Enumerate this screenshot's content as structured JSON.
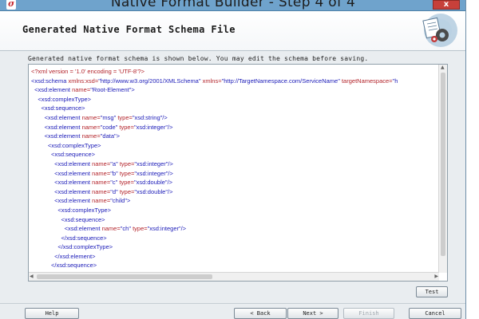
{
  "window": {
    "title": "Native Format Builder - Step 4 of 4",
    "close_label": "x",
    "app_icon_glyph": "σ"
  },
  "header": {
    "title": "Generated Native Format Schema File",
    "logo_icon": "gear-document-icon"
  },
  "description": "Generated native format schema is shown below. You may edit the schema before saving.",
  "code_lines": [
    [
      {
        "t": "pi",
        "v": "<?xml version = '1.0' encoding = 'UTF-8'?>"
      }
    ],
    [
      {
        "t": "tag",
        "v": "<xsd:schema "
      },
      {
        "t": "attr",
        "v": "xmlns:xsd="
      },
      {
        "t": "val",
        "v": "\"http://www.w3.org/2001/XMLSchema\" "
      },
      {
        "t": "attr",
        "v": "xmlns="
      },
      {
        "t": "val",
        "v": "\"http://TargetNamespace.com/ServiceName\" "
      },
      {
        "t": "attr",
        "v": "targetNamespace="
      },
      {
        "t": "val",
        "v": "\"h"
      }
    ],
    [
      {
        "t": "tag",
        "v": "  <xsd:element "
      },
      {
        "t": "attr",
        "v": "name="
      },
      {
        "t": "val",
        "v": "\"Root-Element\">"
      }
    ],
    [
      {
        "t": "tag",
        "v": "    <xsd:complexType>"
      }
    ],
    [
      {
        "t": "tag",
        "v": "      <xsd:sequence>"
      }
    ],
    [
      {
        "t": "tag",
        "v": "        <xsd:element "
      },
      {
        "t": "attr",
        "v": "name="
      },
      {
        "t": "val",
        "v": "\"msg\" "
      },
      {
        "t": "attr",
        "v": "type="
      },
      {
        "t": "val",
        "v": "\"xsd:string\"/>"
      }
    ],
    [
      {
        "t": "tag",
        "v": "        <xsd:element "
      },
      {
        "t": "attr",
        "v": "name="
      },
      {
        "t": "val",
        "v": "\"code\" "
      },
      {
        "t": "attr",
        "v": "type="
      },
      {
        "t": "val",
        "v": "\"xsd:integer\"/>"
      }
    ],
    [
      {
        "t": "tag",
        "v": "        <xsd:element "
      },
      {
        "t": "attr",
        "v": "name="
      },
      {
        "t": "val",
        "v": "\"data\">"
      }
    ],
    [
      {
        "t": "tag",
        "v": "          <xsd:complexType>"
      }
    ],
    [
      {
        "t": "tag",
        "v": "            <xsd:sequence>"
      }
    ],
    [
      {
        "t": "tag",
        "v": "              <xsd:element "
      },
      {
        "t": "attr",
        "v": "name="
      },
      {
        "t": "val",
        "v": "\"a\" "
      },
      {
        "t": "attr",
        "v": "type="
      },
      {
        "t": "val",
        "v": "\"xsd:integer\"/>"
      }
    ],
    [
      {
        "t": "tag",
        "v": "              <xsd:element "
      },
      {
        "t": "attr",
        "v": "name="
      },
      {
        "t": "val",
        "v": "\"b\" "
      },
      {
        "t": "attr",
        "v": "type="
      },
      {
        "t": "val",
        "v": "\"xsd:integer\"/>"
      }
    ],
    [
      {
        "t": "tag",
        "v": "              <xsd:element "
      },
      {
        "t": "attr",
        "v": "name="
      },
      {
        "t": "val",
        "v": "\"c\" "
      },
      {
        "t": "attr",
        "v": "type="
      },
      {
        "t": "val",
        "v": "\"xsd:double\"/>"
      }
    ],
    [
      {
        "t": "tag",
        "v": "              <xsd:element "
      },
      {
        "t": "attr",
        "v": "name="
      },
      {
        "t": "val",
        "v": "\"d\" "
      },
      {
        "t": "attr",
        "v": "type="
      },
      {
        "t": "val",
        "v": "\"xsd:double\"/>"
      }
    ],
    [
      {
        "t": "tag",
        "v": "              <xsd:element "
      },
      {
        "t": "attr",
        "v": "name="
      },
      {
        "t": "val",
        "v": "\"child\">"
      }
    ],
    [
      {
        "t": "tag",
        "v": "                <xsd:complexType>"
      }
    ],
    [
      {
        "t": "tag",
        "v": "                  <xsd:sequence>"
      }
    ],
    [
      {
        "t": "tag",
        "v": "                    <xsd:element "
      },
      {
        "t": "attr",
        "v": "name="
      },
      {
        "t": "val",
        "v": "\"ch\" "
      },
      {
        "t": "attr",
        "v": "type="
      },
      {
        "t": "val",
        "v": "\"xsd:integer\"/>"
      }
    ],
    [
      {
        "t": "tag",
        "v": "                  </xsd:sequence>"
      }
    ],
    [
      {
        "t": "tag",
        "v": "                </xsd:complexType>"
      }
    ],
    [
      {
        "t": "tag",
        "v": "              </xsd:element>"
      }
    ],
    [
      {
        "t": "tag",
        "v": "            </xsd:sequence>"
      }
    ]
  ],
  "buttons": {
    "test": "Test",
    "help": "Help",
    "back": "< Back",
    "next": "Next >",
    "finish": "Finish",
    "cancel": "Cancel"
  },
  "colors": {
    "tag": "#1a1ab8",
    "attribute": "#b3232a",
    "titlebar": "#6fa3cc",
    "close": "#c7403a"
  }
}
